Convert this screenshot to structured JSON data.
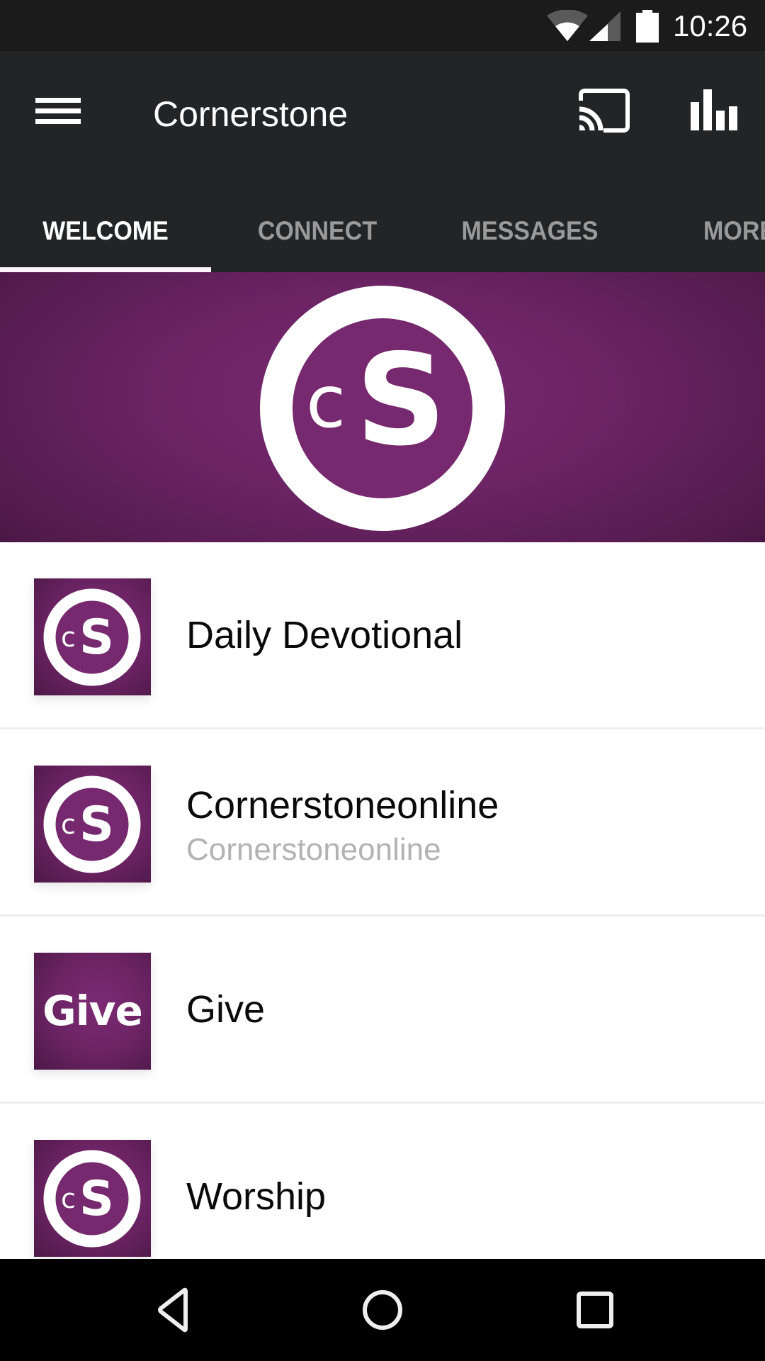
{
  "status_bar": {
    "time": "10:26",
    "icons": [
      "wifi-icon",
      "cellular-signal-icon",
      "battery-icon"
    ]
  },
  "toolbar": {
    "menu_icon": "hamburger-menu-icon",
    "title": "Cornerstone",
    "actions": [
      {
        "name": "cast",
        "icon": "cast-icon"
      },
      {
        "name": "stats",
        "icon": "bar-chart-icon"
      }
    ]
  },
  "tabs": [
    {
      "label": "WELCOME",
      "active": true
    },
    {
      "label": "CONNECT",
      "active": false
    },
    {
      "label": "MESSAGES",
      "active": false
    },
    {
      "label": "MORE",
      "active": false
    }
  ],
  "banner": {
    "logo_text_small": "c",
    "logo_text_large": "S"
  },
  "list": {
    "items": [
      {
        "title": "Daily Devotional",
        "subtitle": "",
        "thumbnail": "cs-logo"
      },
      {
        "title": "Cornerstoneonline",
        "subtitle": "Cornerstoneonline",
        "thumbnail": "cs-logo"
      },
      {
        "title": "Give",
        "subtitle": "",
        "thumbnail": "give",
        "thumbnail_text": "Give"
      },
      {
        "title": "Worship",
        "subtitle": "",
        "thumbnail": "cs-logo"
      }
    ]
  },
  "nav_bar": {
    "buttons": [
      {
        "name": "back",
        "icon": "back-triangle-icon"
      },
      {
        "name": "home",
        "icon": "home-circle-icon"
      },
      {
        "name": "recents",
        "icon": "recents-square-icon"
      }
    ]
  },
  "colors": {
    "toolbar_bg": "#232426",
    "status_bar_bg": "#1b1b1b",
    "brand_purple": "#6a2363",
    "tab_inactive": "#9a9a9a",
    "divider": "#efefef",
    "subtitle": "#b3b3b3"
  }
}
